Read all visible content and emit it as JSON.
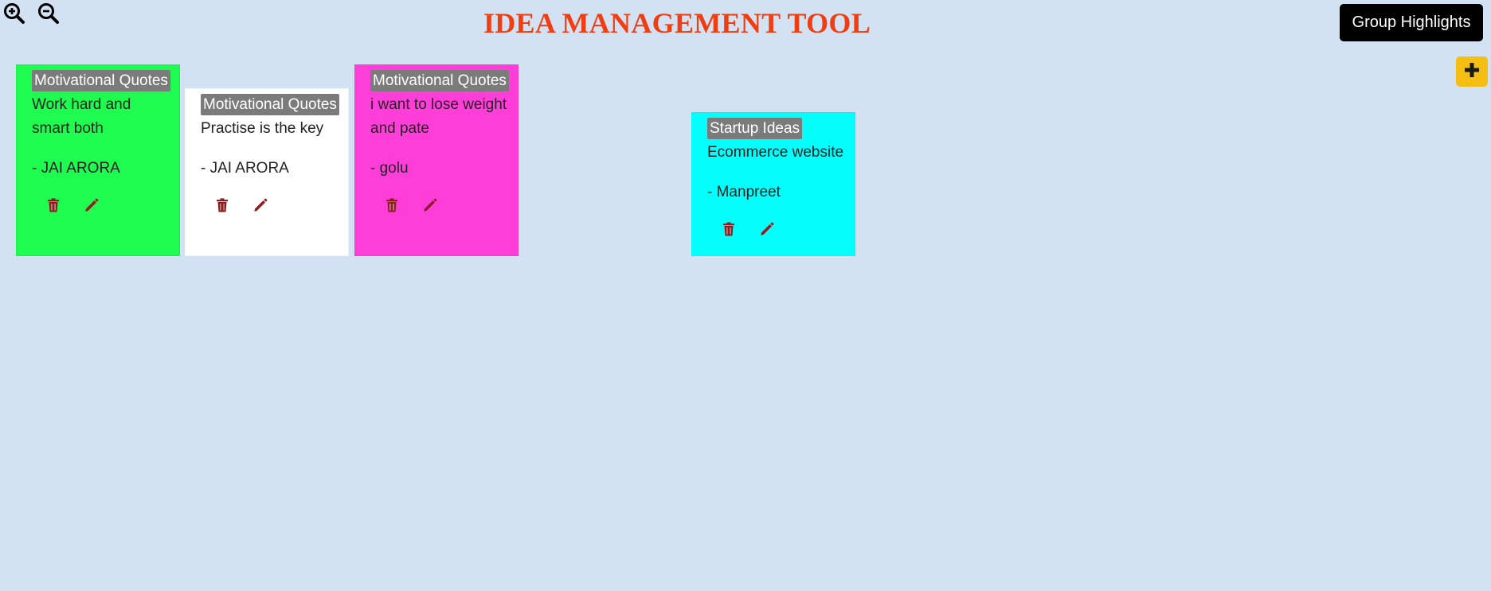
{
  "header": {
    "title": "IDEA MANAGEMENT TOOL",
    "group_button_label": "Group Highlights",
    "zoom_in_icon": "zoom-in-icon",
    "zoom_out_icon": "zoom-out-icon",
    "add_icon": "plus-icon"
  },
  "colors": {
    "background": "#d3e2f3",
    "title": "#f03d12",
    "add_button": "#f5be12",
    "tag_background": "#7b7b7b",
    "action_icon": "#8b1e1e"
  },
  "notes": [
    {
      "tag": "Motivational Quotes",
      "text": "Work hard and smart both",
      "author": "- JAI ARORA",
      "color": "#1efc4f"
    },
    {
      "tag": "Motivational Quotes",
      "text": "Practise is the key",
      "author": "- JAI ARORA",
      "color": "#ffffff"
    },
    {
      "tag": "Motivational Quotes",
      "text": "i want to lose weight and pate",
      "author": "- golu",
      "color": "#ff3ed9"
    },
    {
      "tag": "Startup Ideas",
      "text": "Ecommerce website",
      "author": "- Manpreet",
      "color": "#04fefc"
    }
  ]
}
